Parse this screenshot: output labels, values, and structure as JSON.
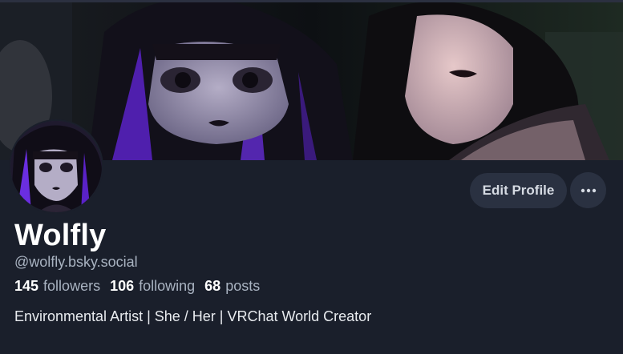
{
  "profile": {
    "display_name": "Wolfly",
    "handle": "@wolfly.bsky.social",
    "bio": "Environmental Artist | She / Her | VRChat World Creator"
  },
  "stats": {
    "followers_count": "145",
    "followers_label": "followers",
    "following_count": "106",
    "following_label": "following",
    "posts_count": "68",
    "posts_label": "posts"
  },
  "actions": {
    "edit_profile_label": "Edit Profile",
    "more_icon": "ellipsis-horizontal-icon"
  },
  "colors": {
    "background": "#1a1f2b",
    "button_bg": "#2a3141",
    "muted_text": "#a9b3c1",
    "accent_purple": "#7b3cff"
  }
}
